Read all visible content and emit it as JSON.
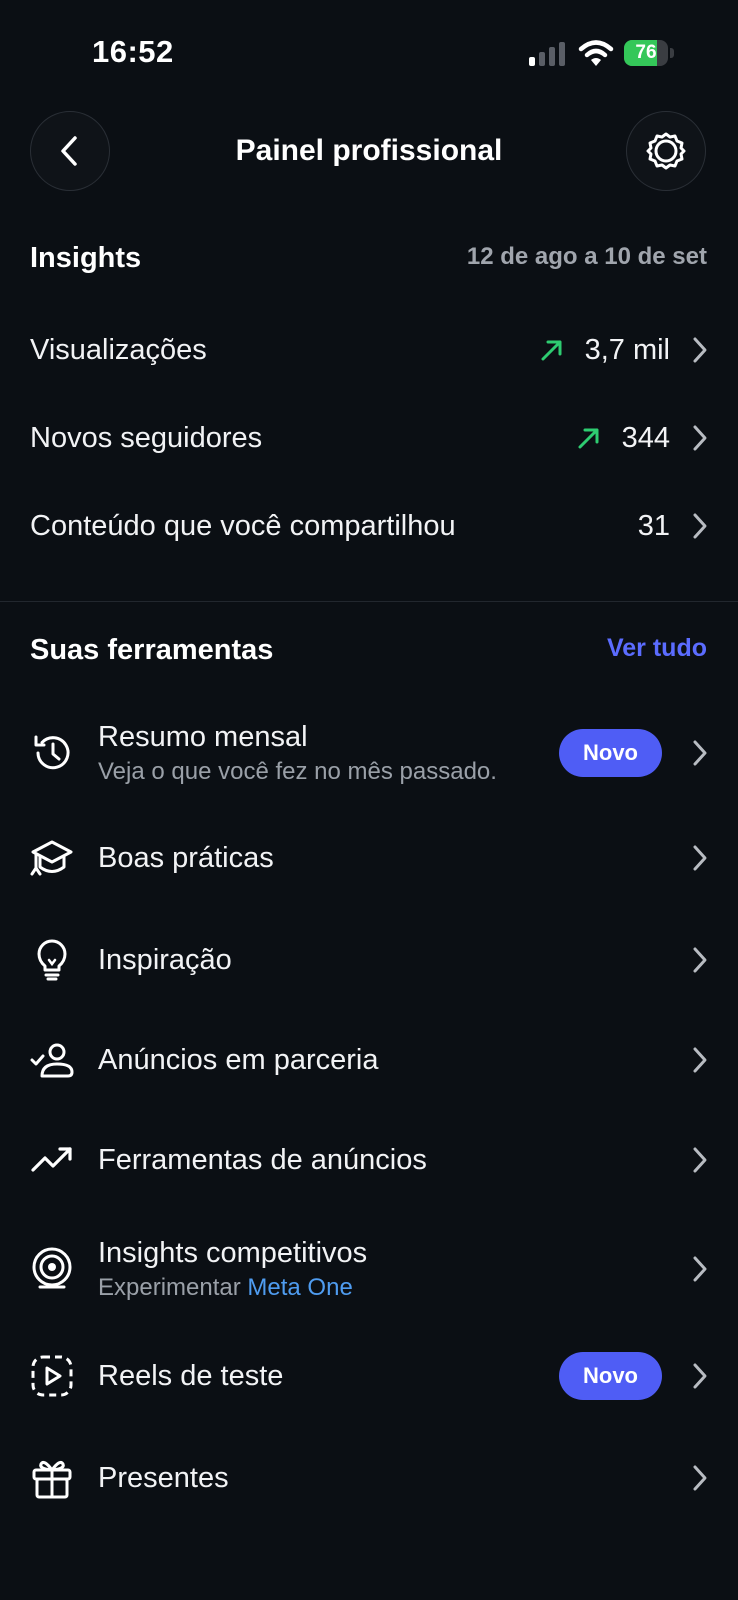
{
  "status_bar": {
    "time": "16:52",
    "battery_level": 76,
    "battery_text": "76"
  },
  "header": {
    "title": "Painel profissional",
    "back_icon": "chevron-left-icon",
    "settings_icon": "gear-icon"
  },
  "insights": {
    "title": "Insights",
    "date_range": "12 de ago a 10 de set",
    "rows": [
      {
        "label": "Visualizações",
        "value": "3,7 mil",
        "trend": "up"
      },
      {
        "label": "Novos seguidores",
        "value": "344",
        "trend": "up"
      },
      {
        "label": "Conteúdo que você compartilhou",
        "value": "31",
        "trend": "none"
      }
    ]
  },
  "tools": {
    "title": "Suas ferramentas",
    "see_all": "Ver tudo",
    "badge_label": "Novo",
    "items": [
      {
        "label": "Resumo mensal",
        "subtitle": "Veja o que você fez no mês passado.",
        "badge": "Novo",
        "icon": "history-clock-icon"
      },
      {
        "label": "Boas práticas",
        "icon": "graduation-cap-icon"
      },
      {
        "label": "Inspiração",
        "icon": "lightbulb-icon"
      },
      {
        "label": "Anúncios em parceria",
        "icon": "user-check-icon"
      },
      {
        "label": "Ferramentas de anúncios",
        "icon": "trending-up-icon"
      },
      {
        "label": "Insights competitivos",
        "subtitle_prefix": "Experimentar",
        "subtitle_link": "Meta One",
        "icon": "broadcast-icon"
      },
      {
        "label": "Reels de teste",
        "badge": "Novo",
        "icon": "reels-test-icon"
      },
      {
        "label": "Presentes",
        "icon": "gift-icon"
      }
    ]
  },
  "colors": {
    "background": "#0b0f14",
    "accent": "#5b6cff",
    "badge": "#4f5df5",
    "trend_up": "#2ecc71",
    "link": "#4f9cf0"
  }
}
